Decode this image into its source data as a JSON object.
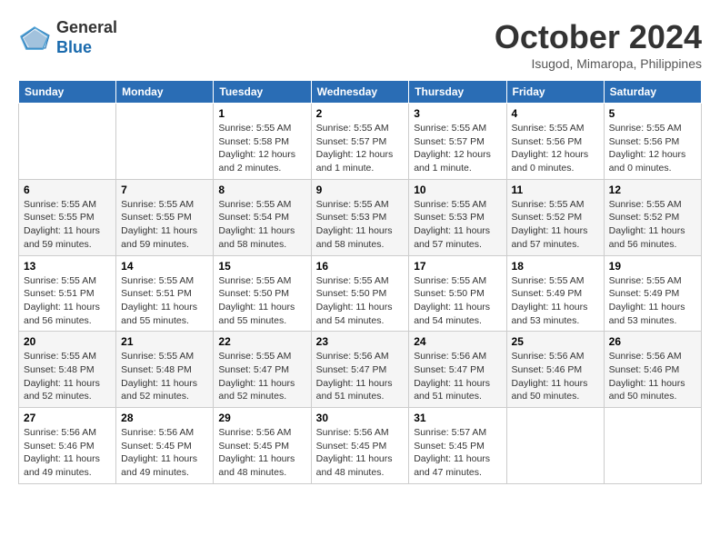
{
  "logo": {
    "line1": "General",
    "line2": "Blue"
  },
  "title": "October 2024",
  "location": "Isugod, Mimaropa, Philippines",
  "weekdays": [
    "Sunday",
    "Monday",
    "Tuesday",
    "Wednesday",
    "Thursday",
    "Friday",
    "Saturday"
  ],
  "weeks": [
    [
      {
        "day": "",
        "info": ""
      },
      {
        "day": "",
        "info": ""
      },
      {
        "day": "1",
        "info": "Sunrise: 5:55 AM\nSunset: 5:58 PM\nDaylight: 12 hours\nand 2 minutes."
      },
      {
        "day": "2",
        "info": "Sunrise: 5:55 AM\nSunset: 5:57 PM\nDaylight: 12 hours\nand 1 minute."
      },
      {
        "day": "3",
        "info": "Sunrise: 5:55 AM\nSunset: 5:57 PM\nDaylight: 12 hours\nand 1 minute."
      },
      {
        "day": "4",
        "info": "Sunrise: 5:55 AM\nSunset: 5:56 PM\nDaylight: 12 hours\nand 0 minutes."
      },
      {
        "day": "5",
        "info": "Sunrise: 5:55 AM\nSunset: 5:56 PM\nDaylight: 12 hours\nand 0 minutes."
      }
    ],
    [
      {
        "day": "6",
        "info": "Sunrise: 5:55 AM\nSunset: 5:55 PM\nDaylight: 11 hours\nand 59 minutes."
      },
      {
        "day": "7",
        "info": "Sunrise: 5:55 AM\nSunset: 5:55 PM\nDaylight: 11 hours\nand 59 minutes."
      },
      {
        "day": "8",
        "info": "Sunrise: 5:55 AM\nSunset: 5:54 PM\nDaylight: 11 hours\nand 58 minutes."
      },
      {
        "day": "9",
        "info": "Sunrise: 5:55 AM\nSunset: 5:53 PM\nDaylight: 11 hours\nand 58 minutes."
      },
      {
        "day": "10",
        "info": "Sunrise: 5:55 AM\nSunset: 5:53 PM\nDaylight: 11 hours\nand 57 minutes."
      },
      {
        "day": "11",
        "info": "Sunrise: 5:55 AM\nSunset: 5:52 PM\nDaylight: 11 hours\nand 57 minutes."
      },
      {
        "day": "12",
        "info": "Sunrise: 5:55 AM\nSunset: 5:52 PM\nDaylight: 11 hours\nand 56 minutes."
      }
    ],
    [
      {
        "day": "13",
        "info": "Sunrise: 5:55 AM\nSunset: 5:51 PM\nDaylight: 11 hours\nand 56 minutes."
      },
      {
        "day": "14",
        "info": "Sunrise: 5:55 AM\nSunset: 5:51 PM\nDaylight: 11 hours\nand 55 minutes."
      },
      {
        "day": "15",
        "info": "Sunrise: 5:55 AM\nSunset: 5:50 PM\nDaylight: 11 hours\nand 55 minutes."
      },
      {
        "day": "16",
        "info": "Sunrise: 5:55 AM\nSunset: 5:50 PM\nDaylight: 11 hours\nand 54 minutes."
      },
      {
        "day": "17",
        "info": "Sunrise: 5:55 AM\nSunset: 5:50 PM\nDaylight: 11 hours\nand 54 minutes."
      },
      {
        "day": "18",
        "info": "Sunrise: 5:55 AM\nSunset: 5:49 PM\nDaylight: 11 hours\nand 53 minutes."
      },
      {
        "day": "19",
        "info": "Sunrise: 5:55 AM\nSunset: 5:49 PM\nDaylight: 11 hours\nand 53 minutes."
      }
    ],
    [
      {
        "day": "20",
        "info": "Sunrise: 5:55 AM\nSunset: 5:48 PM\nDaylight: 11 hours\nand 52 minutes."
      },
      {
        "day": "21",
        "info": "Sunrise: 5:55 AM\nSunset: 5:48 PM\nDaylight: 11 hours\nand 52 minutes."
      },
      {
        "day": "22",
        "info": "Sunrise: 5:55 AM\nSunset: 5:47 PM\nDaylight: 11 hours\nand 52 minutes."
      },
      {
        "day": "23",
        "info": "Sunrise: 5:56 AM\nSunset: 5:47 PM\nDaylight: 11 hours\nand 51 minutes."
      },
      {
        "day": "24",
        "info": "Sunrise: 5:56 AM\nSunset: 5:47 PM\nDaylight: 11 hours\nand 51 minutes."
      },
      {
        "day": "25",
        "info": "Sunrise: 5:56 AM\nSunset: 5:46 PM\nDaylight: 11 hours\nand 50 minutes."
      },
      {
        "day": "26",
        "info": "Sunrise: 5:56 AM\nSunset: 5:46 PM\nDaylight: 11 hours\nand 50 minutes."
      }
    ],
    [
      {
        "day": "27",
        "info": "Sunrise: 5:56 AM\nSunset: 5:46 PM\nDaylight: 11 hours\nand 49 minutes."
      },
      {
        "day": "28",
        "info": "Sunrise: 5:56 AM\nSunset: 5:45 PM\nDaylight: 11 hours\nand 49 minutes."
      },
      {
        "day": "29",
        "info": "Sunrise: 5:56 AM\nSunset: 5:45 PM\nDaylight: 11 hours\nand 48 minutes."
      },
      {
        "day": "30",
        "info": "Sunrise: 5:56 AM\nSunset: 5:45 PM\nDaylight: 11 hours\nand 48 minutes."
      },
      {
        "day": "31",
        "info": "Sunrise: 5:57 AM\nSunset: 5:45 PM\nDaylight: 11 hours\nand 47 minutes."
      },
      {
        "day": "",
        "info": ""
      },
      {
        "day": "",
        "info": ""
      }
    ]
  ]
}
